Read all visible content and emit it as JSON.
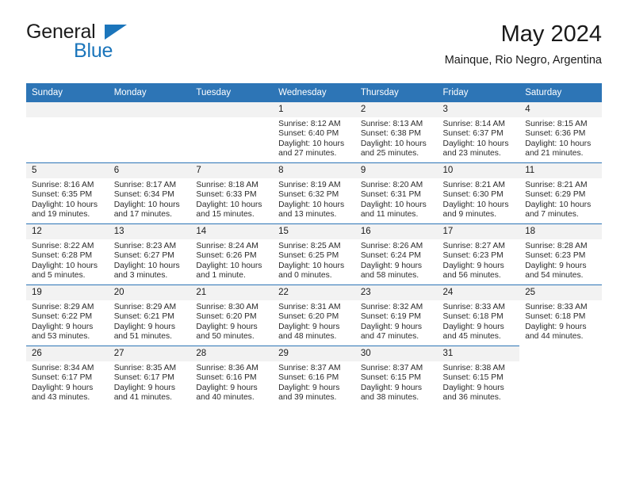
{
  "logo": {
    "word_one": "General",
    "word_two": "Blue"
  },
  "header": {
    "title": "May 2024",
    "subtitle": "Mainque, Rio Negro, Argentina"
  },
  "theme": {
    "accent": "#2d75b6",
    "logo_blue": "#1b75bb",
    "daynum_band": "#f2f2f2",
    "text": "#1a1a1a"
  },
  "weekday_headers": [
    "Sunday",
    "Monday",
    "Tuesday",
    "Wednesday",
    "Thursday",
    "Friday",
    "Saturday"
  ],
  "weeks": [
    [
      {
        "day": "",
        "lines": []
      },
      {
        "day": "",
        "lines": []
      },
      {
        "day": "",
        "lines": []
      },
      {
        "day": "1",
        "lines": [
          "Sunrise: 8:12 AM",
          "Sunset: 6:40 PM",
          "Daylight: 10 hours",
          "and 27 minutes."
        ]
      },
      {
        "day": "2",
        "lines": [
          "Sunrise: 8:13 AM",
          "Sunset: 6:38 PM",
          "Daylight: 10 hours",
          "and 25 minutes."
        ]
      },
      {
        "day": "3",
        "lines": [
          "Sunrise: 8:14 AM",
          "Sunset: 6:37 PM",
          "Daylight: 10 hours",
          "and 23 minutes."
        ]
      },
      {
        "day": "4",
        "lines": [
          "Sunrise: 8:15 AM",
          "Sunset: 6:36 PM",
          "Daylight: 10 hours",
          "and 21 minutes."
        ]
      }
    ],
    [
      {
        "day": "5",
        "lines": [
          "Sunrise: 8:16 AM",
          "Sunset: 6:35 PM",
          "Daylight: 10 hours",
          "and 19 minutes."
        ]
      },
      {
        "day": "6",
        "lines": [
          "Sunrise: 8:17 AM",
          "Sunset: 6:34 PM",
          "Daylight: 10 hours",
          "and 17 minutes."
        ]
      },
      {
        "day": "7",
        "lines": [
          "Sunrise: 8:18 AM",
          "Sunset: 6:33 PM",
          "Daylight: 10 hours",
          "and 15 minutes."
        ]
      },
      {
        "day": "8",
        "lines": [
          "Sunrise: 8:19 AM",
          "Sunset: 6:32 PM",
          "Daylight: 10 hours",
          "and 13 minutes."
        ]
      },
      {
        "day": "9",
        "lines": [
          "Sunrise: 8:20 AM",
          "Sunset: 6:31 PM",
          "Daylight: 10 hours",
          "and 11 minutes."
        ]
      },
      {
        "day": "10",
        "lines": [
          "Sunrise: 8:21 AM",
          "Sunset: 6:30 PM",
          "Daylight: 10 hours",
          "and 9 minutes."
        ]
      },
      {
        "day": "11",
        "lines": [
          "Sunrise: 8:21 AM",
          "Sunset: 6:29 PM",
          "Daylight: 10 hours",
          "and 7 minutes."
        ]
      }
    ],
    [
      {
        "day": "12",
        "lines": [
          "Sunrise: 8:22 AM",
          "Sunset: 6:28 PM",
          "Daylight: 10 hours",
          "and 5 minutes."
        ]
      },
      {
        "day": "13",
        "lines": [
          "Sunrise: 8:23 AM",
          "Sunset: 6:27 PM",
          "Daylight: 10 hours",
          "and 3 minutes."
        ]
      },
      {
        "day": "14",
        "lines": [
          "Sunrise: 8:24 AM",
          "Sunset: 6:26 PM",
          "Daylight: 10 hours",
          "and 1 minute."
        ]
      },
      {
        "day": "15",
        "lines": [
          "Sunrise: 8:25 AM",
          "Sunset: 6:25 PM",
          "Daylight: 10 hours",
          "and 0 minutes."
        ]
      },
      {
        "day": "16",
        "lines": [
          "Sunrise: 8:26 AM",
          "Sunset: 6:24 PM",
          "Daylight: 9 hours",
          "and 58 minutes."
        ]
      },
      {
        "day": "17",
        "lines": [
          "Sunrise: 8:27 AM",
          "Sunset: 6:23 PM",
          "Daylight: 9 hours",
          "and 56 minutes."
        ]
      },
      {
        "day": "18",
        "lines": [
          "Sunrise: 8:28 AM",
          "Sunset: 6:23 PM",
          "Daylight: 9 hours",
          "and 54 minutes."
        ]
      }
    ],
    [
      {
        "day": "19",
        "lines": [
          "Sunrise: 8:29 AM",
          "Sunset: 6:22 PM",
          "Daylight: 9 hours",
          "and 53 minutes."
        ]
      },
      {
        "day": "20",
        "lines": [
          "Sunrise: 8:29 AM",
          "Sunset: 6:21 PM",
          "Daylight: 9 hours",
          "and 51 minutes."
        ]
      },
      {
        "day": "21",
        "lines": [
          "Sunrise: 8:30 AM",
          "Sunset: 6:20 PM",
          "Daylight: 9 hours",
          "and 50 minutes."
        ]
      },
      {
        "day": "22",
        "lines": [
          "Sunrise: 8:31 AM",
          "Sunset: 6:20 PM",
          "Daylight: 9 hours",
          "and 48 minutes."
        ]
      },
      {
        "day": "23",
        "lines": [
          "Sunrise: 8:32 AM",
          "Sunset: 6:19 PM",
          "Daylight: 9 hours",
          "and 47 minutes."
        ]
      },
      {
        "day": "24",
        "lines": [
          "Sunrise: 8:33 AM",
          "Sunset: 6:18 PM",
          "Daylight: 9 hours",
          "and 45 minutes."
        ]
      },
      {
        "day": "25",
        "lines": [
          "Sunrise: 8:33 AM",
          "Sunset: 6:18 PM",
          "Daylight: 9 hours",
          "and 44 minutes."
        ]
      }
    ],
    [
      {
        "day": "26",
        "lines": [
          "Sunrise: 8:34 AM",
          "Sunset: 6:17 PM",
          "Daylight: 9 hours",
          "and 43 minutes."
        ]
      },
      {
        "day": "27",
        "lines": [
          "Sunrise: 8:35 AM",
          "Sunset: 6:17 PM",
          "Daylight: 9 hours",
          "and 41 minutes."
        ]
      },
      {
        "day": "28",
        "lines": [
          "Sunrise: 8:36 AM",
          "Sunset: 6:16 PM",
          "Daylight: 9 hours",
          "and 40 minutes."
        ]
      },
      {
        "day": "29",
        "lines": [
          "Sunrise: 8:37 AM",
          "Sunset: 6:16 PM",
          "Daylight: 9 hours",
          "and 39 minutes."
        ]
      },
      {
        "day": "30",
        "lines": [
          "Sunrise: 8:37 AM",
          "Sunset: 6:15 PM",
          "Daylight: 9 hours",
          "and 38 minutes."
        ]
      },
      {
        "day": "31",
        "lines": [
          "Sunrise: 8:38 AM",
          "Sunset: 6:15 PM",
          "Daylight: 9 hours",
          "and 36 minutes."
        ]
      }
    ]
  ]
}
